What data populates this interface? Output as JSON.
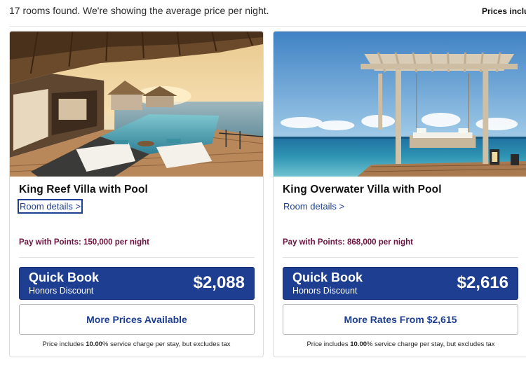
{
  "header": {
    "summary": "17 rooms found. We're showing the average price per night.",
    "prices_note": "Prices include"
  },
  "rooms": [
    {
      "name": "King Reef Villa with Pool",
      "details_link": "Room details >",
      "points": "Pay with Points: 150,000 per night",
      "quick_book": {
        "title": "Quick Book",
        "subtitle": "Honors Discount",
        "price": "$2,088"
      },
      "more_button": "More Prices Available",
      "disclaimer_prefix": "Price includes ",
      "disclaimer_rate": "10.00",
      "disclaimer_suffix": "% service charge per stay, but excludes tax"
    },
    {
      "name": "King Overwater Villa with Pool",
      "details_link": "Room details >",
      "points": "Pay with Points: 868,000 per night",
      "quick_book": {
        "title": "Quick Book",
        "subtitle": "Honors Discount",
        "price": "$2,616"
      },
      "more_button": "More Rates From $2,615",
      "disclaimer_prefix": "Price includes ",
      "disclaimer_rate": "10.00",
      "disclaimer_suffix": "% service charge per stay, but excludes tax"
    }
  ],
  "colors": {
    "brand_blue": "#1d3e91",
    "link_blue": "#1c3f94",
    "points_maroon": "#6b1340"
  }
}
